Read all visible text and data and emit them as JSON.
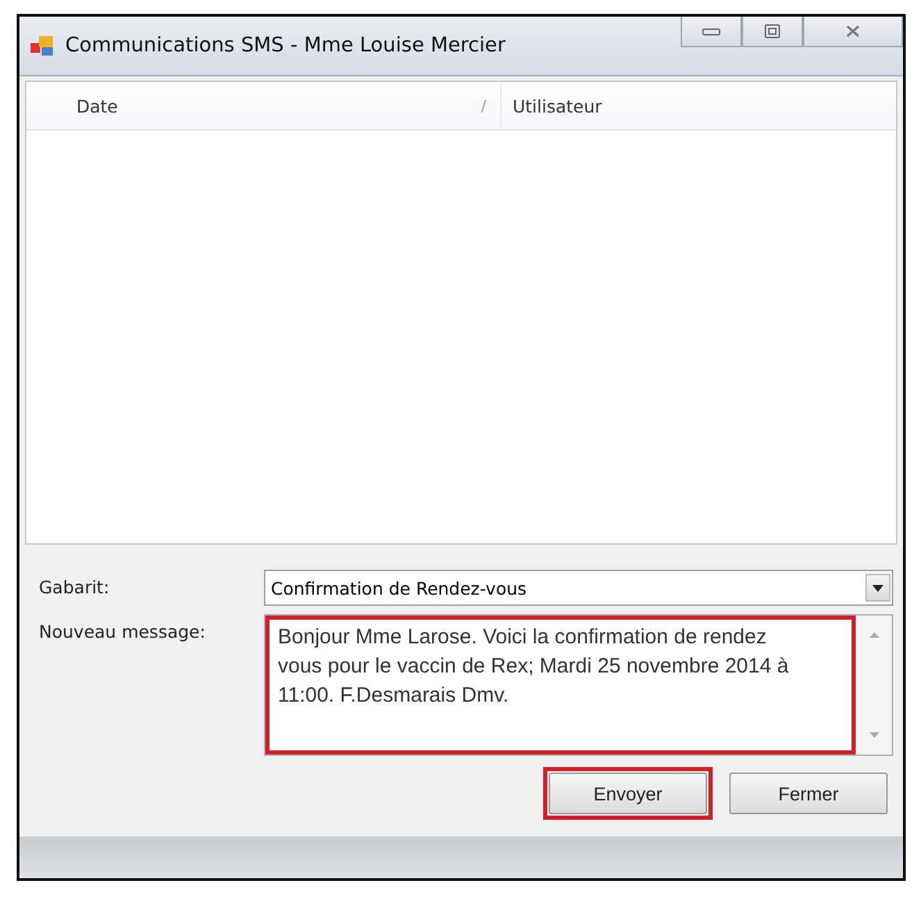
{
  "window": {
    "title": "Communications SMS - Mme Louise Mercier"
  },
  "table": {
    "columns": [
      {
        "label": "Date",
        "sort_mark": "/"
      },
      {
        "label": "Utilisateur"
      }
    ]
  },
  "template": {
    "label": "Gabarit:",
    "value": "Confirmation de Rendez-vous"
  },
  "message": {
    "label": "Nouveau message:",
    "value": "Bonjour Mme Larose. Voici la confirmation de rendez vous pour le vaccin de Rex; Mardi 25 novembre 2014 à 11:00. F.Desmarais Dmv.",
    "highlighted": true
  },
  "buttons": [
    {
      "label": "Envoyer",
      "highlighted": true
    },
    {
      "label": "Fermer",
      "highlighted": false
    }
  ]
}
